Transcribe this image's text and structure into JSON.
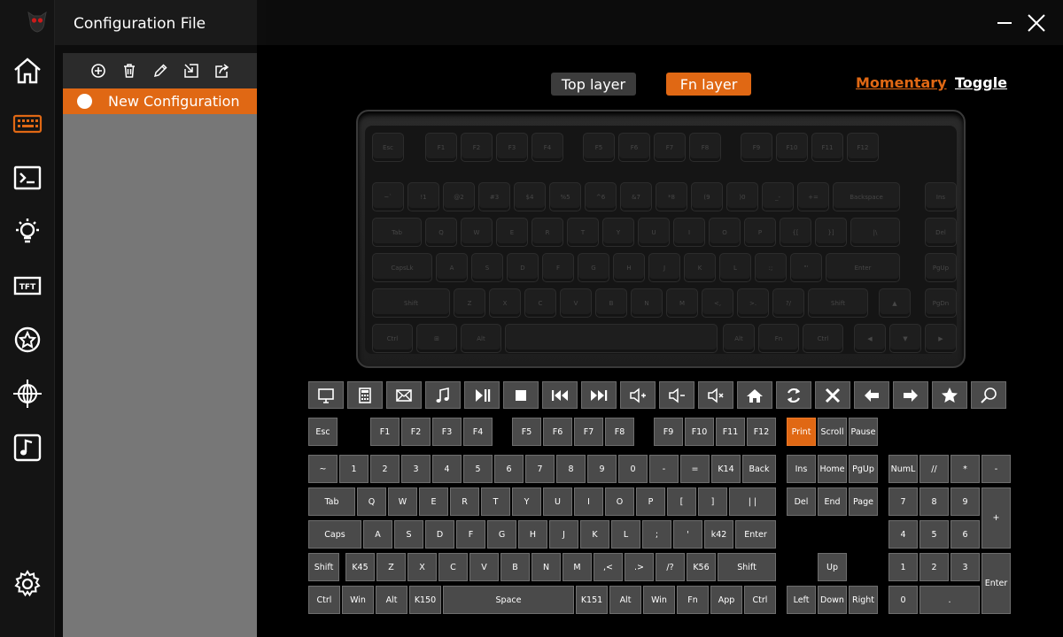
{
  "header": {
    "title": "Configuration File"
  },
  "config": {
    "items": [
      {
        "name": "New Configuration"
      }
    ]
  },
  "layers": {
    "top": "Top layer",
    "fn": "Fn layer"
  },
  "modes": {
    "momentary": "Momentary",
    "toggle": "Toggle"
  },
  "colors": {
    "accent": "#e06814",
    "key_bg": "#4a4a4a",
    "panel": "#777777"
  },
  "rail_icons": [
    "home-icon",
    "keyboard-icon",
    "terminal-icon",
    "lightbulb-icon",
    "tft-icon",
    "star-badge-icon",
    "globe-icon",
    "music-note-icon",
    "gear-icon"
  ],
  "function_icons": [
    "monitor-icon",
    "calculator-icon",
    "mail-icon",
    "music-icon",
    "play-pause-icon",
    "stop-icon",
    "previous-track-icon",
    "next-track-icon",
    "volume-up-icon",
    "volume-down-icon",
    "mute-icon",
    "home-icon",
    "refresh-icon",
    "close-icon",
    "arrow-left-icon",
    "arrow-right-icon",
    "star-icon",
    "search-icon"
  ],
  "keymap": {
    "row_f": [
      "Esc",
      "F1",
      "F2",
      "F3",
      "F4",
      "F5",
      "F6",
      "F7",
      "F8",
      "F9",
      "F10",
      "F11",
      "F12",
      "Print",
      "Scroll",
      "Pause"
    ],
    "row_num": [
      "~",
      "1",
      "2",
      "3",
      "4",
      "5",
      "6",
      "7",
      "8",
      "9",
      "0",
      "-",
      "=",
      "K14",
      "Back"
    ],
    "row_q": [
      "Tab",
      "Q",
      "W",
      "E",
      "R",
      "T",
      "Y",
      "U",
      "I",
      "O",
      "P",
      "[",
      "]",
      "| |"
    ],
    "row_a": [
      "Caps",
      "A",
      "S",
      "D",
      "F",
      "G",
      "H",
      "J",
      "K",
      "L",
      ";",
      "'",
      "k42",
      "Enter"
    ],
    "row_z": [
      "Shift",
      "K45",
      "Z",
      "X",
      "C",
      "V",
      "B",
      "N",
      "M",
      ",<",
      ".>",
      "/?",
      "K56",
      "Shift"
    ],
    "row_b": [
      "Ctrl",
      "Win",
      "Alt",
      "K150",
      "Space",
      "K151",
      "Alt",
      "Win",
      "Fn",
      "App",
      "Ctrl"
    ],
    "nav": [
      "Ins",
      "Home",
      "PgUp",
      "Del",
      "End",
      "Page",
      "Up",
      "Left",
      "Down",
      "Right"
    ],
    "numpad": [
      "NumL",
      "//",
      "*",
      "-",
      "7",
      "8",
      "9",
      "+",
      "4",
      "5",
      "6",
      "1",
      "2",
      "3",
      "Enter",
      "0",
      "."
    ],
    "selected": "Print"
  },
  "photo_keys": {
    "f": [
      "Esc",
      "F1",
      "F2",
      "F3",
      "F4",
      "F5",
      "F6",
      "F7",
      "F8",
      "F9",
      "F10",
      "F11",
      "F12"
    ],
    "num": [
      "~`",
      "!1",
      "@2",
      "#3",
      "$4",
      "%5",
      "^6",
      "&7",
      "*8",
      "(9",
      ")0",
      "_-",
      "+=",
      "Backspace",
      "Ins"
    ],
    "q": [
      "Tab",
      "Q",
      "W",
      "E",
      "R",
      "T",
      "Y",
      "U",
      "I",
      "O",
      "P",
      "{[",
      "}]",
      "|\\",
      "Del"
    ],
    "a": [
      "CapsLk",
      "A",
      "S",
      "D",
      "F",
      "G",
      "H",
      "J",
      "K",
      "L",
      ":;",
      "\"'",
      "Enter",
      "PgUp"
    ],
    "z": [
      "Shift",
      "Z",
      "X",
      "C",
      "V",
      "B",
      "N",
      "M",
      "<,",
      ">.",
      "?/",
      "Shift",
      "▲",
      "PgDn"
    ],
    "b": [
      "Ctrl",
      "⊞",
      "Alt",
      "",
      "Alt",
      "Fn",
      "Ctrl",
      "◀",
      "▼",
      "▶"
    ]
  }
}
